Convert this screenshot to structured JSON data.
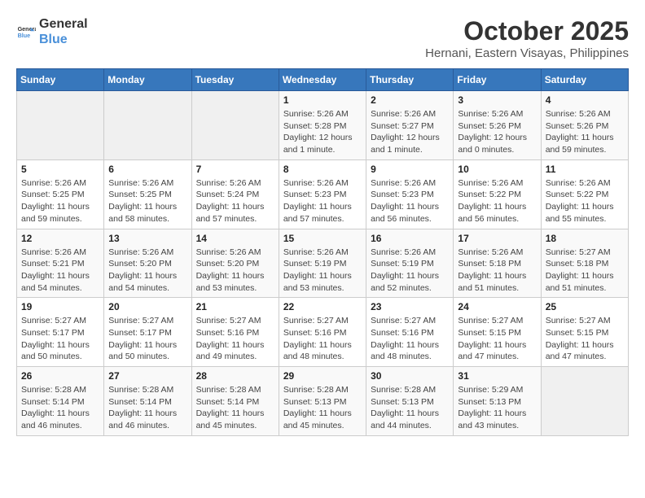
{
  "logo": {
    "line1": "General",
    "line2": "Blue"
  },
  "title": "October 2025",
  "subtitle": "Hernani, Eastern Visayas, Philippines",
  "days_of_week": [
    "Sunday",
    "Monday",
    "Tuesday",
    "Wednesday",
    "Thursday",
    "Friday",
    "Saturday"
  ],
  "weeks": [
    [
      {
        "day": "",
        "info": ""
      },
      {
        "day": "",
        "info": ""
      },
      {
        "day": "",
        "info": ""
      },
      {
        "day": "1",
        "info": "Sunrise: 5:26 AM\nSunset: 5:28 PM\nDaylight: 12 hours\nand 1 minute."
      },
      {
        "day": "2",
        "info": "Sunrise: 5:26 AM\nSunset: 5:27 PM\nDaylight: 12 hours\nand 1 minute."
      },
      {
        "day": "3",
        "info": "Sunrise: 5:26 AM\nSunset: 5:26 PM\nDaylight: 12 hours\nand 0 minutes."
      },
      {
        "day": "4",
        "info": "Sunrise: 5:26 AM\nSunset: 5:26 PM\nDaylight: 11 hours\nand 59 minutes."
      }
    ],
    [
      {
        "day": "5",
        "info": "Sunrise: 5:26 AM\nSunset: 5:25 PM\nDaylight: 11 hours\nand 59 minutes."
      },
      {
        "day": "6",
        "info": "Sunrise: 5:26 AM\nSunset: 5:25 PM\nDaylight: 11 hours\nand 58 minutes."
      },
      {
        "day": "7",
        "info": "Sunrise: 5:26 AM\nSunset: 5:24 PM\nDaylight: 11 hours\nand 57 minutes."
      },
      {
        "day": "8",
        "info": "Sunrise: 5:26 AM\nSunset: 5:23 PM\nDaylight: 11 hours\nand 57 minutes."
      },
      {
        "day": "9",
        "info": "Sunrise: 5:26 AM\nSunset: 5:23 PM\nDaylight: 11 hours\nand 56 minutes."
      },
      {
        "day": "10",
        "info": "Sunrise: 5:26 AM\nSunset: 5:22 PM\nDaylight: 11 hours\nand 56 minutes."
      },
      {
        "day": "11",
        "info": "Sunrise: 5:26 AM\nSunset: 5:22 PM\nDaylight: 11 hours\nand 55 minutes."
      }
    ],
    [
      {
        "day": "12",
        "info": "Sunrise: 5:26 AM\nSunset: 5:21 PM\nDaylight: 11 hours\nand 54 minutes."
      },
      {
        "day": "13",
        "info": "Sunrise: 5:26 AM\nSunset: 5:20 PM\nDaylight: 11 hours\nand 54 minutes."
      },
      {
        "day": "14",
        "info": "Sunrise: 5:26 AM\nSunset: 5:20 PM\nDaylight: 11 hours\nand 53 minutes."
      },
      {
        "day": "15",
        "info": "Sunrise: 5:26 AM\nSunset: 5:19 PM\nDaylight: 11 hours\nand 53 minutes."
      },
      {
        "day": "16",
        "info": "Sunrise: 5:26 AM\nSunset: 5:19 PM\nDaylight: 11 hours\nand 52 minutes."
      },
      {
        "day": "17",
        "info": "Sunrise: 5:26 AM\nSunset: 5:18 PM\nDaylight: 11 hours\nand 51 minutes."
      },
      {
        "day": "18",
        "info": "Sunrise: 5:27 AM\nSunset: 5:18 PM\nDaylight: 11 hours\nand 51 minutes."
      }
    ],
    [
      {
        "day": "19",
        "info": "Sunrise: 5:27 AM\nSunset: 5:17 PM\nDaylight: 11 hours\nand 50 minutes."
      },
      {
        "day": "20",
        "info": "Sunrise: 5:27 AM\nSunset: 5:17 PM\nDaylight: 11 hours\nand 50 minutes."
      },
      {
        "day": "21",
        "info": "Sunrise: 5:27 AM\nSunset: 5:16 PM\nDaylight: 11 hours\nand 49 minutes."
      },
      {
        "day": "22",
        "info": "Sunrise: 5:27 AM\nSunset: 5:16 PM\nDaylight: 11 hours\nand 48 minutes."
      },
      {
        "day": "23",
        "info": "Sunrise: 5:27 AM\nSunset: 5:16 PM\nDaylight: 11 hours\nand 48 minutes."
      },
      {
        "day": "24",
        "info": "Sunrise: 5:27 AM\nSunset: 5:15 PM\nDaylight: 11 hours\nand 47 minutes."
      },
      {
        "day": "25",
        "info": "Sunrise: 5:27 AM\nSunset: 5:15 PM\nDaylight: 11 hours\nand 47 minutes."
      }
    ],
    [
      {
        "day": "26",
        "info": "Sunrise: 5:28 AM\nSunset: 5:14 PM\nDaylight: 11 hours\nand 46 minutes."
      },
      {
        "day": "27",
        "info": "Sunrise: 5:28 AM\nSunset: 5:14 PM\nDaylight: 11 hours\nand 46 minutes."
      },
      {
        "day": "28",
        "info": "Sunrise: 5:28 AM\nSunset: 5:14 PM\nDaylight: 11 hours\nand 45 minutes."
      },
      {
        "day": "29",
        "info": "Sunrise: 5:28 AM\nSunset: 5:13 PM\nDaylight: 11 hours\nand 45 minutes."
      },
      {
        "day": "30",
        "info": "Sunrise: 5:28 AM\nSunset: 5:13 PM\nDaylight: 11 hours\nand 44 minutes."
      },
      {
        "day": "31",
        "info": "Sunrise: 5:29 AM\nSunset: 5:13 PM\nDaylight: 11 hours\nand 43 minutes."
      },
      {
        "day": "",
        "info": ""
      }
    ]
  ]
}
